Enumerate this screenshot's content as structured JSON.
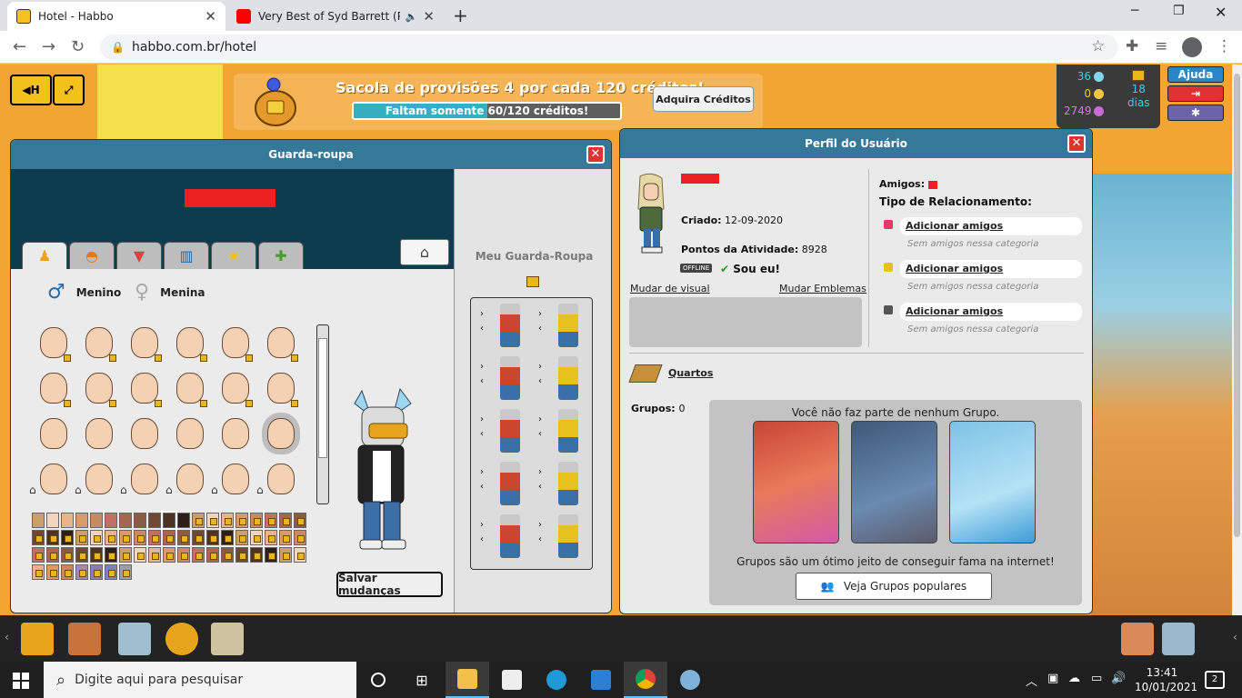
{
  "browser": {
    "tabs": [
      {
        "title": "Hotel - Habbo",
        "active": true
      },
      {
        "title": "Very Best of Syd Barrett (Pink",
        "active": false
      }
    ],
    "url": "habbo.com.br/hotel"
  },
  "promo": {
    "title": "Sacola de provisões 4 por cada 120 créditos!",
    "progress_label": "Faltam somente 60/120 créditos!",
    "progress": 0.5,
    "button": "Adquira Créditos"
  },
  "currency": {
    "diamonds": "36",
    "credits": "0",
    "duckets": "2749",
    "club_days": "18",
    "club_unit": "dias"
  },
  "side_buttons": {
    "help": "Ajuda"
  },
  "wardrobe": {
    "title": "Guarda-roupa",
    "gender_male": "Menino",
    "gender_female": "Menina",
    "my_wardrobe": "Meu Guarda-Roupa",
    "save": "Salvar mudanças"
  },
  "profile": {
    "title": "Perfil do Usuário",
    "created_label": "Criado:",
    "created_value": "12-09-2020",
    "points_label": "Pontos da Atividade:",
    "points_value": "8928",
    "offline": "OFFLINE",
    "its_me": "Sou eu!",
    "change_look": "Mudar de visual",
    "change_badges": "Mudar Emblemas",
    "friends_label": "Amigos:",
    "relationship_label": "Tipo de Relacionamento:",
    "relationships": [
      {
        "action": "Adicionar amigos",
        "empty": "Sem amigos nessa categoria",
        "color": "#e23b6a"
      },
      {
        "action": "Adicionar amigos",
        "empty": "Sem amigos nessa categoria",
        "color": "#e8c21c"
      },
      {
        "action": "Adicionar amigos",
        "empty": "Sem amigos nessa categoria",
        "color": "#555555"
      }
    ],
    "rooms": "Quartos",
    "groups_label": "Grupos:",
    "groups_count": "0",
    "no_group": "Você não faz parte de nenhum Grupo.",
    "groups_tagline": "Grupos são um ótimo jeito de conseguir fama na internet!",
    "popular_groups": "Veja Grupos populares"
  },
  "taskbar": {
    "search_placeholder": "Digite aqui para pesquisar",
    "time": "13:41",
    "date": "10/01/2021",
    "notifications": "2"
  }
}
